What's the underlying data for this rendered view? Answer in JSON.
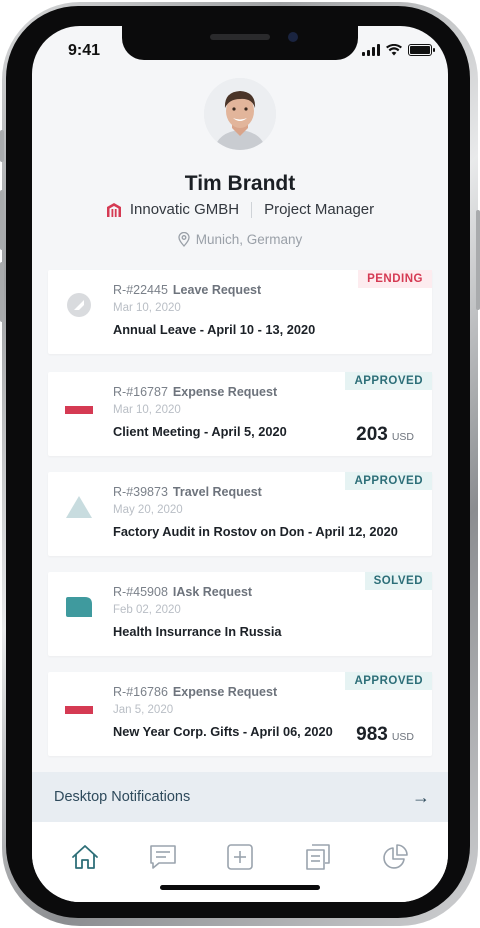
{
  "status_bar": {
    "time": "9:41"
  },
  "profile": {
    "name": "Tim Brandt",
    "company": "Innovatic GMBH",
    "role": "Project Manager",
    "location": "Munich, Germany"
  },
  "requests": [
    {
      "id": "R-#22445",
      "type": "Leave Request",
      "date": "Mar 10, 2020",
      "title": "Annual Leave - April 10 - 13, 2020",
      "status": "PENDING",
      "icon": "circle-slash-icon"
    },
    {
      "id": "R-#16787",
      "type": "Expense Request",
      "date": "Mar 10, 2020",
      "title": "Client Meeting - April 5, 2020",
      "status": "APPROVED",
      "amount": "203",
      "currency": "USD",
      "icon": "red-bar-icon"
    },
    {
      "id": "R-#39873",
      "type": "Travel Request",
      "date": "May 20, 2020",
      "title": "Factory Audit in Rostov on Don - April 12, 2020",
      "status": "APPROVED",
      "icon": "triangle-icon"
    },
    {
      "id": "R-#45908",
      "type": "IAsk Request",
      "date": "Feb 02, 2020",
      "title": "Health Insurrance In Russia",
      "status": "SOLVED",
      "icon": "chat-bubble-icon"
    },
    {
      "id": "R-#16786",
      "type": "Expense Request",
      "date": "Jan 5, 2020",
      "title": "New Year Corp. Gifts - April 06, 2020",
      "status": "APPROVED",
      "amount": "983",
      "currency": "USD",
      "icon": "red-bar-icon"
    }
  ],
  "notifications": {
    "label": "Desktop Notifications",
    "arrow": "→"
  },
  "tabs": [
    "home-icon",
    "chat-icon",
    "add-icon",
    "documents-icon",
    "pie-chart-icon"
  ],
  "colors": {
    "pending": "#d53a53",
    "approved": "#2c6e78",
    "accent_teal": "#3f9a9e",
    "accent_red": "#d53a53"
  }
}
